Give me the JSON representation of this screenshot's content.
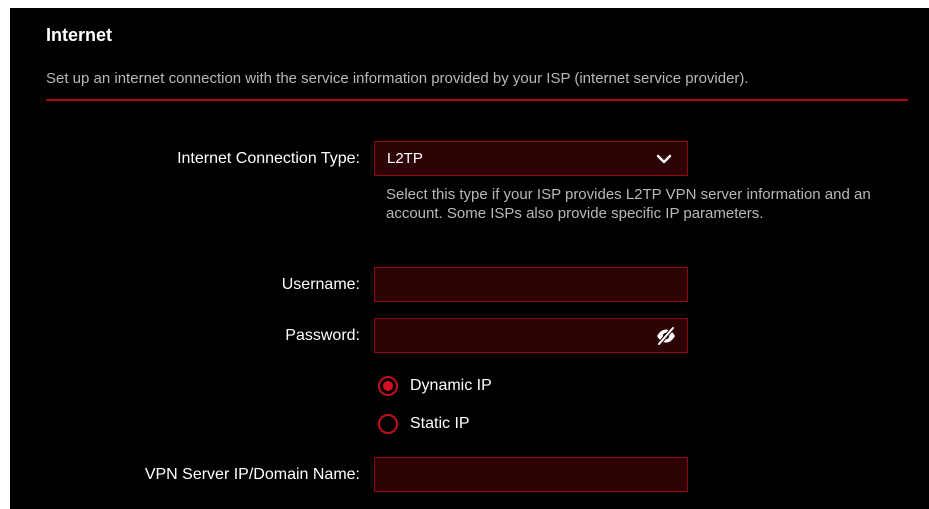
{
  "section": {
    "title": "Internet",
    "description": "Set up an internet connection with the service information provided by your ISP (internet service provider)."
  },
  "connection_type": {
    "label": "Internet Connection Type:",
    "selected": "L2TP",
    "help": "Select this type if your ISP provides L2TP VPN server information and an account. Some ISPs also provide specific IP parameters."
  },
  "username": {
    "label": "Username:",
    "value": ""
  },
  "password": {
    "label": "Password:",
    "value": ""
  },
  "ip_mode": {
    "options": [
      {
        "label": "Dynamic IP",
        "checked": true
      },
      {
        "label": "Static IP",
        "checked": false
      }
    ]
  },
  "vpn_server": {
    "label": "VPN Server IP/Domain Name:",
    "value": ""
  },
  "colors": {
    "background": "#000000",
    "accent": "#d4111f",
    "field_fill": "#2e0306",
    "field_border": "#8c0a14",
    "muted_text": "#b8b8b8"
  },
  "icons": {
    "dropdown": "chevron-down-icon",
    "password_toggle": "eye-slash-icon"
  }
}
